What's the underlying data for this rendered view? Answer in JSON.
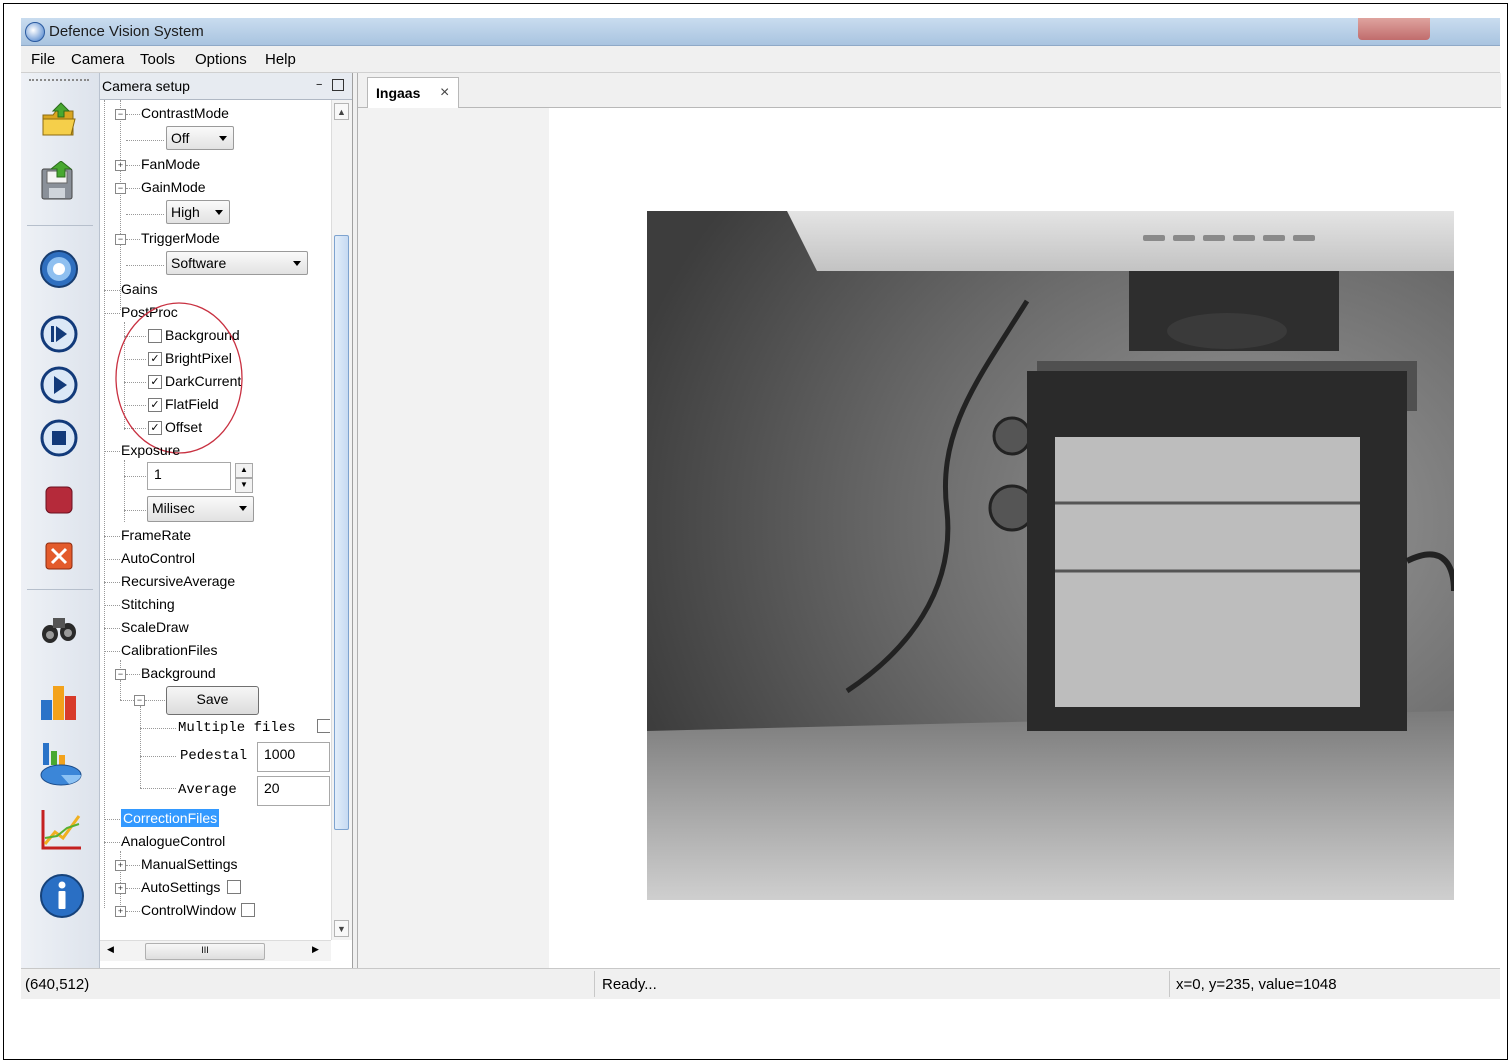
{
  "window": {
    "title": "Defence Vision System"
  },
  "menu": [
    "File",
    "Camera",
    "Tools",
    "Options",
    "Help"
  ],
  "toolbar": {
    "icons": [
      "open-folder-icon",
      "save-icon",
      "camera-capture-icon",
      "step-play-icon",
      "play-icon",
      "stop-icon",
      "record-icon",
      "close-icon",
      "binoculars-icon",
      "bar-chart-icon",
      "pie-chart-icon",
      "line-chart-icon",
      "info-icon"
    ]
  },
  "panel": {
    "title": "Camera setup",
    "pin_glyph": "−",
    "tree": {
      "contrast_mode": {
        "label": "ContrastMode",
        "value": "Off"
      },
      "fan_mode": {
        "label": "FanMode"
      },
      "gain_mode": {
        "label": "GainMode",
        "value": "High"
      },
      "trigger_mode": {
        "label": "TriggerMode",
        "value": "Software"
      },
      "gains": {
        "label": "Gains"
      },
      "postproc": {
        "label": "PostProc",
        "items": [
          {
            "label": "Background",
            "checked": false
          },
          {
            "label": "BrightPixel",
            "checked": true
          },
          {
            "label": "DarkCurrent",
            "checked": true
          },
          {
            "label": "FlatField",
            "checked": true
          },
          {
            "label": "Offset",
            "checked": true
          }
        ]
      },
      "exposure": {
        "label": "Exposure",
        "value": "1",
        "unit": "Milisec"
      },
      "frame_rate": {
        "label": "FrameRate"
      },
      "auto_control": {
        "label": "AutoControl"
      },
      "recursive_average": {
        "label": "RecursiveAverage"
      },
      "stitching": {
        "label": "Stitching"
      },
      "scale_draw": {
        "label": "ScaleDraw"
      },
      "calibration_files": {
        "label": "CalibrationFiles",
        "background": {
          "label": "Background",
          "save_label": "Save",
          "multiple_files_label": "Multiple files",
          "pedestal_label": "Pedestal",
          "pedestal_value": "1000",
          "average_label": "Average",
          "average_value": "20"
        }
      },
      "correction_files": {
        "label": "CorrectionFiles"
      },
      "analogue_control": {
        "label": "AnalogueControl"
      },
      "manual_settings": {
        "label": "ManualSettings"
      },
      "auto_settings": {
        "label": "AutoSettings"
      },
      "control_window": {
        "label": "ControlWindow"
      }
    },
    "hscroll_grip": "III"
  },
  "document": {
    "tab_label": "Ingaas",
    "tab_close": "×"
  },
  "status": {
    "resolution": "(640,512)",
    "message": "Ready...",
    "pixel_info": "x=0, y=235, value=1048"
  }
}
